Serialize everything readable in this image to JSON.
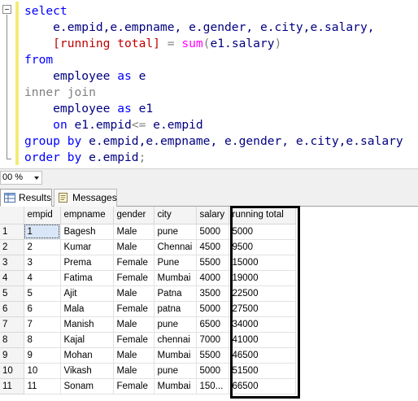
{
  "editor": {
    "lines": [
      [
        {
          "t": "select",
          "c": "kw"
        }
      ],
      [
        {
          "t": "    e.empid,e.empname, e.gender, e.city,e.salary,",
          "c": "tx"
        }
      ],
      [
        {
          "t": "    [running total] ",
          "c": "rd"
        },
        {
          "t": "= ",
          "c": "gr"
        },
        {
          "t": "sum",
          "c": "pk"
        },
        {
          "t": "(",
          "c": "gr"
        },
        {
          "t": "e1.salary",
          "c": "tx"
        },
        {
          "t": ")",
          "c": "gr"
        }
      ],
      [
        {
          "t": "from",
          "c": "kw"
        }
      ],
      [
        {
          "t": "    employee ",
          "c": "tx"
        },
        {
          "t": "as",
          "c": "kw"
        },
        {
          "t": " e",
          "c": "tx"
        }
      ],
      [
        {
          "t": "inner join",
          "c": "gr"
        }
      ],
      [
        {
          "t": "    employee ",
          "c": "tx"
        },
        {
          "t": "as",
          "c": "kw"
        },
        {
          "t": " e1",
          "c": "tx"
        }
      ],
      [
        {
          "t": "    ",
          "c": "tx"
        },
        {
          "t": "on",
          "c": "kw"
        },
        {
          "t": " e1.empid",
          "c": "tx"
        },
        {
          "t": "<=",
          "c": "gr"
        },
        {
          "t": " e.empid",
          "c": "tx"
        }
      ],
      [
        {
          "t": "group by",
          "c": "kw"
        },
        {
          "t": " e.empid,e.empname, e.gender, e.city,e.salary",
          "c": "tx"
        }
      ],
      [
        {
          "t": "order by",
          "c": "kw"
        },
        {
          "t": " e.empid",
          "c": "tx"
        },
        {
          "t": ";",
          "c": "gr"
        }
      ]
    ]
  },
  "zoom": {
    "value": "00 %"
  },
  "tabs": {
    "results": "Results",
    "messages": "Messages"
  },
  "grid": {
    "columns": [
      "empid",
      "empname",
      "gender",
      "city",
      "salary",
      "running total"
    ],
    "rows": [
      [
        "1",
        "1",
        "Bagesh",
        "Male",
        "pune",
        "5000",
        "5000"
      ],
      [
        "2",
        "2",
        "Kumar",
        "Male",
        "Chennai",
        "4500",
        "9500"
      ],
      [
        "3",
        "3",
        "Prema",
        "Female",
        "Pune",
        "5500",
        "15000"
      ],
      [
        "4",
        "4",
        "Fatima",
        "Female",
        "Mumbai",
        "4000",
        "19000"
      ],
      [
        "5",
        "5",
        "Ajit",
        "Male",
        "Patna",
        "3500",
        "22500"
      ],
      [
        "6",
        "6",
        "Mala",
        "Female",
        "patna",
        "5000",
        "27500"
      ],
      [
        "7",
        "7",
        "Manish",
        "Male",
        "pune",
        "6500",
        "34000"
      ],
      [
        "8",
        "8",
        "Kajal",
        "Female",
        "chennai",
        "7000",
        "41000"
      ],
      [
        "9",
        "9",
        "Mohan",
        "Male",
        "Mumbai",
        "5500",
        "46500"
      ],
      [
        "10",
        "10",
        "Vikash",
        "Male",
        "pune",
        "5000",
        "51500"
      ],
      [
        "11",
        "11",
        "Sonam",
        "Female",
        "Mumbai",
        "150...",
        "66500"
      ]
    ]
  },
  "colors": {
    "keyword": "#0000ff",
    "identifier": "#000080",
    "operator": "#808080",
    "function": "#ff00ff",
    "bracket": "#c00000"
  }
}
